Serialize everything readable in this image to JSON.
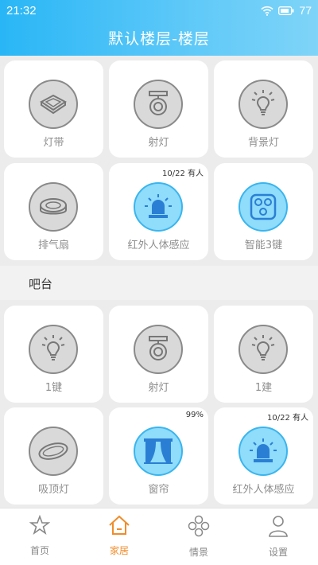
{
  "statusbar": {
    "time": "21:32",
    "battery": "77"
  },
  "header": {
    "title": "默认楼层-楼层"
  },
  "group": {
    "title": "吧台"
  },
  "cards": [
    {
      "label": "灯带",
      "icon": "panel-light-icon",
      "state": "off",
      "badge": ""
    },
    {
      "label": "射灯",
      "icon": "spotlight-icon",
      "state": "off",
      "badge": ""
    },
    {
      "label": "背景灯",
      "icon": "bulb-icon",
      "state": "off",
      "badge": ""
    },
    {
      "label": "排气扇",
      "icon": "exhaust-fan-icon",
      "state": "off",
      "badge": ""
    },
    {
      "label": "红外人体感应",
      "icon": "alarm-light-icon",
      "state": "on",
      "badge": "10/22 有人"
    },
    {
      "label": "智能3键",
      "icon": "three-key-switch-icon",
      "state": "on",
      "badge": ""
    },
    {
      "label": "1键",
      "icon": "bulb-icon",
      "state": "off",
      "badge": ""
    },
    {
      "label": "射灯",
      "icon": "spotlight-icon",
      "state": "off",
      "badge": ""
    },
    {
      "label": "1建",
      "icon": "bulb-icon",
      "state": "off",
      "badge": ""
    },
    {
      "label": "吸顶灯",
      "icon": "ceiling-light-icon",
      "state": "off",
      "badge": ""
    },
    {
      "label": "窗帘",
      "icon": "curtain-icon",
      "state": "on",
      "badge": "99%"
    },
    {
      "label": "红外人体感应",
      "icon": "alarm-light-icon",
      "state": "on",
      "badge": "10/22 有人"
    }
  ],
  "tabs": [
    {
      "label": "首页",
      "icon": "star-icon",
      "active": false
    },
    {
      "label": "家居",
      "icon": "house-icon",
      "active": true
    },
    {
      "label": "情景",
      "icon": "scene-icon",
      "active": false
    },
    {
      "label": "设置",
      "icon": "user-icon",
      "active": false
    }
  ],
  "colors": {
    "accent": "#29b6f6",
    "active_tab": "#f08c2a",
    "icon_on": "#8fdcfb"
  }
}
